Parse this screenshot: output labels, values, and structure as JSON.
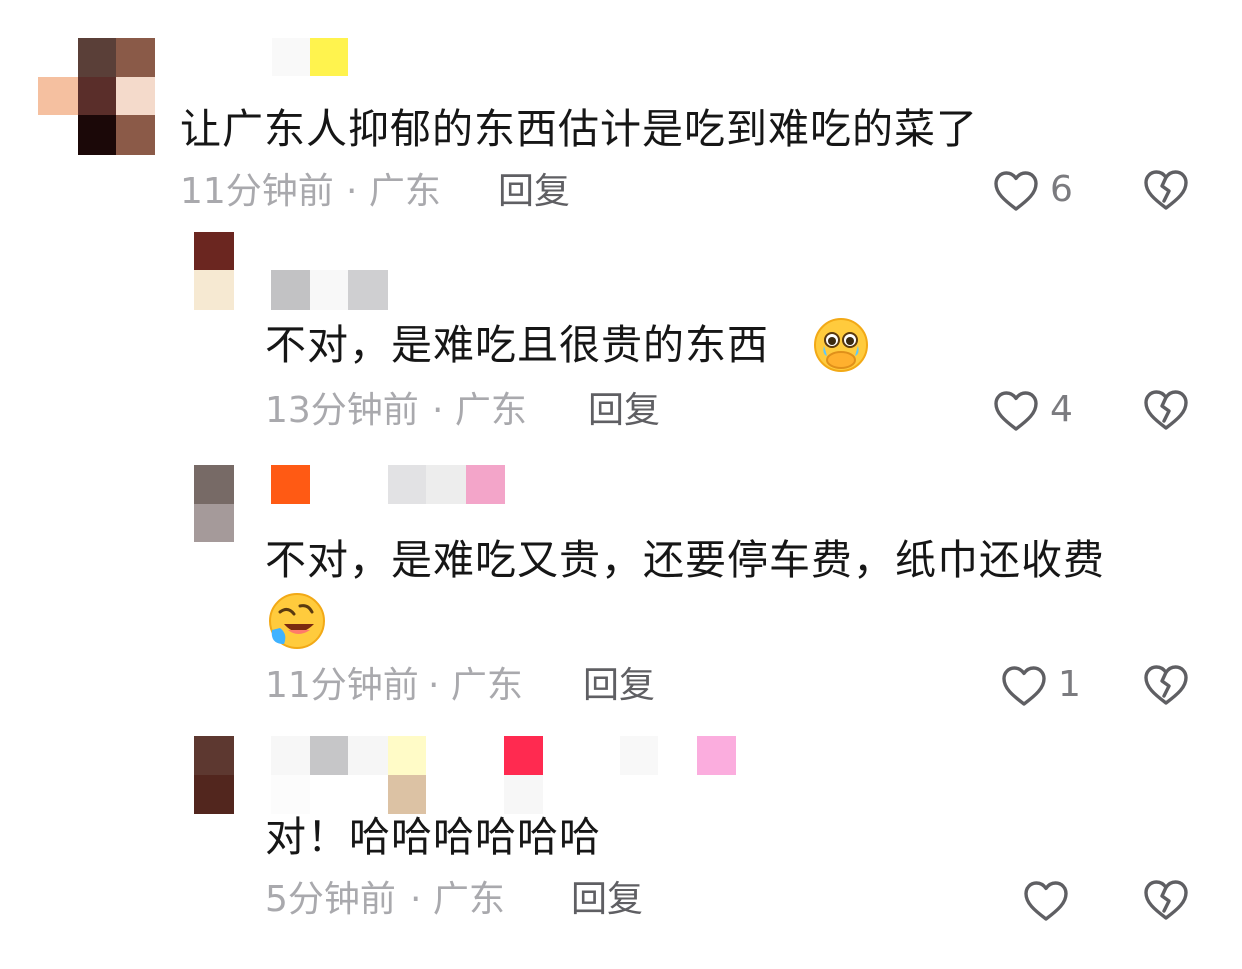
{
  "comments": [
    {
      "text": "让广东人抑郁的东西估计是吃到难吃的菜了",
      "time": "11分钟前",
      "location": "· 广东",
      "reply": "回复",
      "likes": "6"
    },
    {
      "text": "不对，是难吃且很贵的东西",
      "emoji": "crying-face-emoji",
      "time": "13分钟前",
      "location": "· 广东",
      "reply": "回复",
      "likes": "4"
    },
    {
      "text": "不对，是难吃又贵，还要停车费，纸巾还收费",
      "emoji": "rolling-laughing-emoji",
      "time": "11分钟前",
      "location": "· 广东",
      "reply": "回复",
      "likes": "1"
    },
    {
      "text": "对！哈哈哈哈哈哈",
      "time": "5分钟前",
      "location": "· 广东",
      "reply": "回复",
      "likes": ""
    }
  ],
  "icons": {
    "like": "heart-outline-icon",
    "dislike": "broken-heart-icon"
  }
}
